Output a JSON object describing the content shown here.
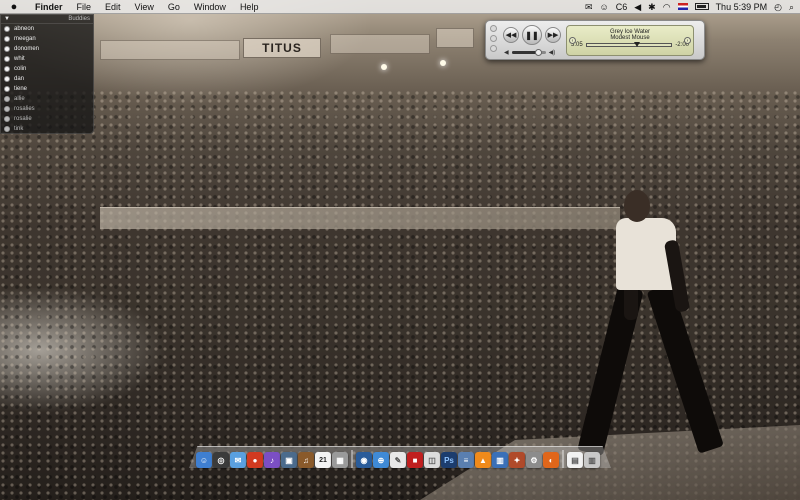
{
  "menubar": {
    "items": [
      "Finder",
      "File",
      "Edit",
      "View",
      "Go",
      "Window",
      "Help"
    ],
    "status": {
      "battery_text": "C6",
      "clock": "Thu 5:39 PM"
    }
  },
  "buddies": {
    "title": "Buddies",
    "items": [
      {
        "name": "abneon",
        "status": "available"
      },
      {
        "name": "meegan",
        "status": "available"
      },
      {
        "name": "donomen",
        "status": "available"
      },
      {
        "name": "whit",
        "status": "available"
      },
      {
        "name": "colin",
        "status": "available"
      },
      {
        "name": "dan",
        "status": "available"
      },
      {
        "name": "tiene",
        "status": "available"
      },
      {
        "name": "allie",
        "status": "away"
      },
      {
        "name": "rosalies",
        "status": "away"
      },
      {
        "name": "rosalie",
        "status": "away"
      },
      {
        "name": "tink",
        "status": "away"
      }
    ]
  },
  "itunes": {
    "song": "Grey Ice Water",
    "artist": "Modest Mouse",
    "elapsed": "3:05",
    "remaining": "-2:00",
    "progress_fraction": 0.6,
    "volume_fraction": 0.8
  },
  "wallpaper": {
    "banner_text": "TITUS"
  },
  "dock": {
    "calendar_day": "21",
    "photoshop_label": "Ps",
    "icons": [
      {
        "name": "finder-icon",
        "color": "#3f7fd1",
        "glyph": "☺"
      },
      {
        "name": "dashboard-icon",
        "color": "#3b3b3b",
        "glyph": "◎"
      },
      {
        "name": "ichat-icon",
        "color": "#5aa0e0",
        "glyph": "✉"
      },
      {
        "name": "tomato-app-icon",
        "color": "#d23a20",
        "glyph": "●"
      },
      {
        "name": "itunes-icon",
        "color": "#7b4fc4",
        "glyph": "♪"
      },
      {
        "name": "iphoto-icon",
        "color": "#4b6b8c",
        "glyph": "▣"
      },
      {
        "name": "garageband-icon",
        "color": "#8a5a2b",
        "glyph": "♫"
      },
      {
        "name": "calendar-icon",
        "color": "#f3f3f3",
        "glyph": ""
      },
      {
        "name": "calculator-icon",
        "color": "#9a9a9a",
        "glyph": "▦"
      },
      {
        "name": "separator"
      },
      {
        "name": "globe-icon",
        "color": "#2a5c9a",
        "glyph": "◉"
      },
      {
        "name": "safari-icon",
        "color": "#3f8ad6",
        "glyph": "⊕"
      },
      {
        "name": "textedit-icon",
        "color": "#e8e8e8",
        "glyph": "✎"
      },
      {
        "name": "red-app-icon",
        "color": "#c01f1f",
        "glyph": "■"
      },
      {
        "name": "preview-icon",
        "color": "#dcdcdc",
        "glyph": "◫"
      },
      {
        "name": "photoshop-icon",
        "color": "#1c3d6e",
        "glyph": ""
      },
      {
        "name": "script-icon",
        "color": "#5a7fb0",
        "glyph": "≡"
      },
      {
        "name": "vlc-icon",
        "color": "#f08a1a",
        "glyph": "▲"
      },
      {
        "name": "chart-app-icon",
        "color": "#3a70b8",
        "glyph": "▥"
      },
      {
        "name": "tools-icon",
        "color": "#b04a2a",
        "glyph": "✦"
      },
      {
        "name": "system-preferences-icon",
        "color": "#8c8c8c",
        "glyph": "⚙"
      },
      {
        "name": "firefox-icon",
        "color": "#e0661a",
        "glyph": "◐"
      },
      {
        "name": "separator"
      },
      {
        "name": "document-icon",
        "color": "#f2f2f2",
        "glyph": "▤"
      },
      {
        "name": "trash-icon",
        "color": "#c8c8c8",
        "glyph": "▥"
      }
    ]
  }
}
